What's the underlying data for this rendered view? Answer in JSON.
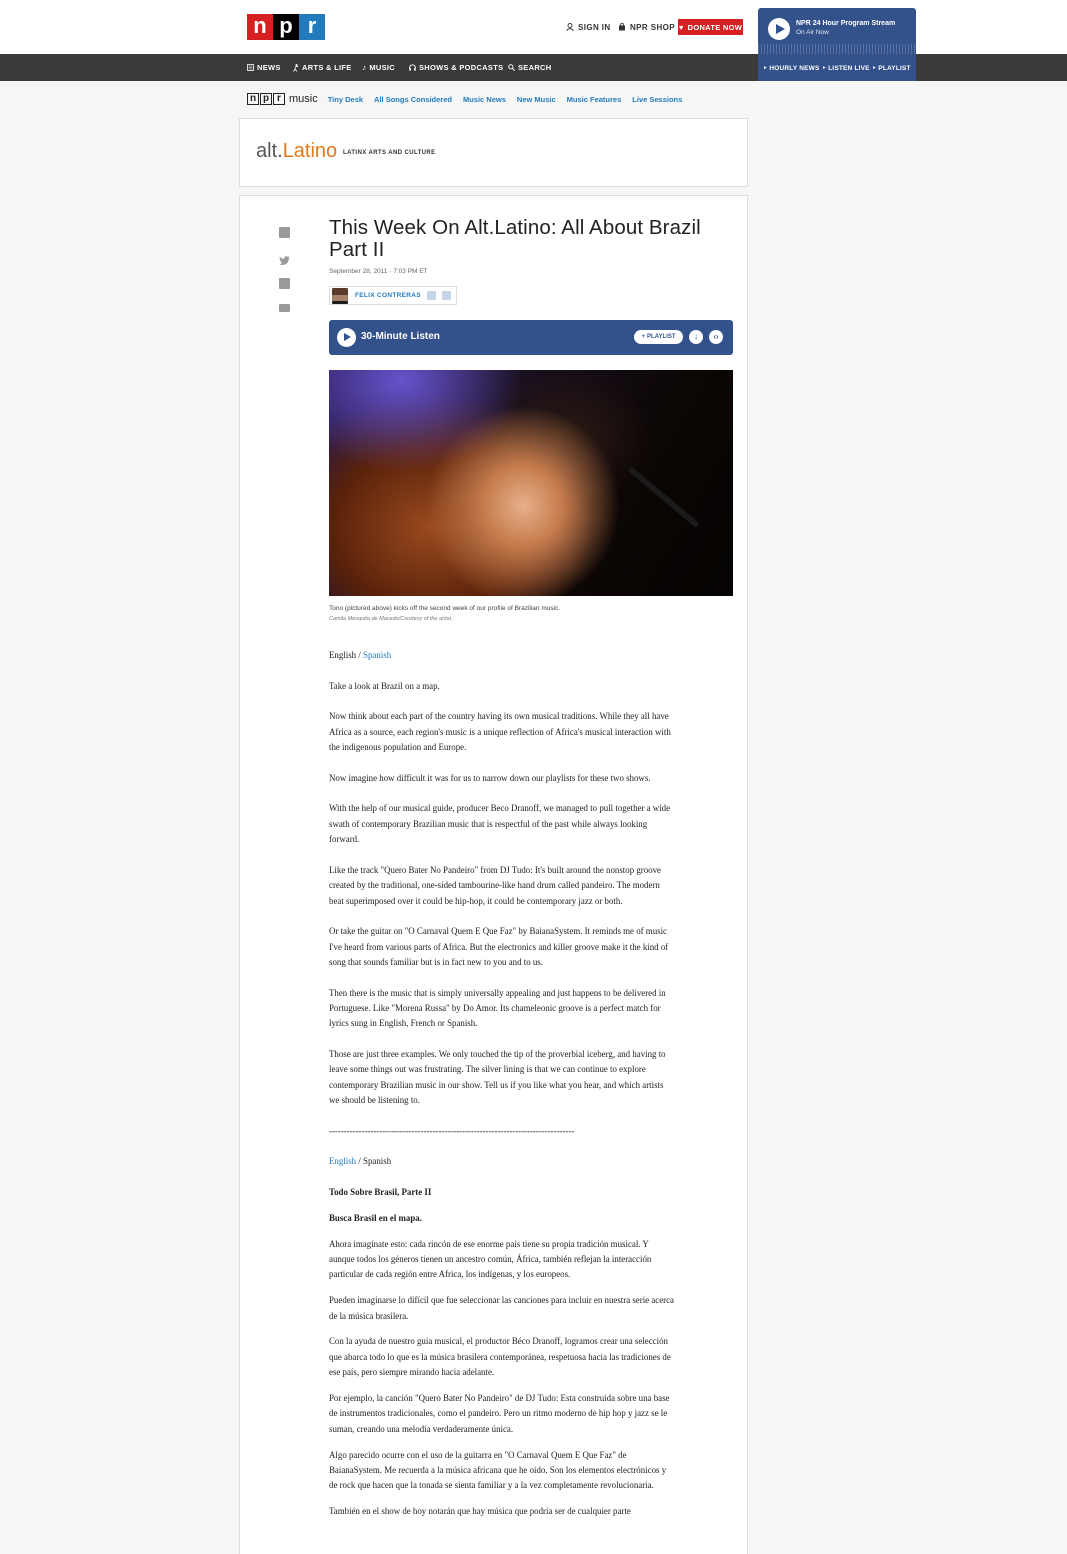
{
  "header": {
    "logo": [
      "n",
      "p",
      "r"
    ],
    "sign_in": "SIGN IN",
    "shop": "NPR SHOP",
    "donate": "DONATE NOW",
    "player": {
      "title": "NPR 24 Hour Program Stream",
      "subtitle": "On Air Now"
    },
    "player_links": [
      "HOURLY NEWS",
      "LISTEN LIVE",
      "PLAYLIST"
    ]
  },
  "nav": [
    "NEWS",
    "ARTS & LIFE",
    "MUSIC",
    "SHOWS & PODCASTS",
    "SEARCH"
  ],
  "subnav": {
    "brand_letters": [
      "n",
      "p",
      "r"
    ],
    "brand_word": "music",
    "links": [
      "Tiny Desk",
      "All Songs Considered",
      "Music News",
      "New Music",
      "Music Features",
      "Live Sessions"
    ]
  },
  "blog": {
    "name_prefix": "alt.",
    "name_suffix": "Latino",
    "tagline": "LATINX ARTS AND CULTURE"
  },
  "article": {
    "title": "This Week On Alt.Latino: All About Brazil Part II",
    "date": "September 28, 2011 · 7:03 PM ET",
    "author": "FELIX CONTRERAS",
    "audio": {
      "label": "30-Minute Listen",
      "playlist": "PLAYLIST"
    },
    "caption": "Tono (pictured above) kicks off the second week of our profile of Brazilian music.",
    "credit": "Camila Mesquita de Macedo/Courtesy of the artist.",
    "lang_en_1": "English",
    "lang_sep": " / ",
    "lang_es_1": "Spanish",
    "paragraphs_en": [
      "Take a look at Brazil on a map.",
      "Now think about each part of the country having its own musical traditions. While they all have Africa as a source, each region's music is a unique reflection of Africa's musical interaction with the indigenous population and Europe.",
      "Now imagine how difficult it was for us to narrow down our playlists for these two shows.",
      "With the help of our musical guide, producer Beco Dranoff, we managed to pull together a wide swath of contemporary Brazilian music that is respectful of the past while always looking forward.",
      "Like the track \"Quero Bater No Pandeiro\" from DJ Tudo: It's built around the nonstop groove created by the traditional, one-sided tambourine-like hand drum called pandeiro. The modern beat superimposed over it could be hip-hop, it could be contemporary jazz or both.",
      "Or take the guitar on \"O Carnaval Quem E Que Faz\" by BaianaSystem. It reminds me of music I've heard from various parts of Africa. But the electronics and killer groove make it the kind of song that sounds familiar but is in fact new to you and to us.",
      "Then there is the music that is simply universally appealing and just happens to be delivered in Portuguese. Like \"Morena Russa\" by Do Amor. Its chameleonic groove is a perfect match for lyrics sung in English, French or Spanish.",
      "Those are just three examples. We only touched the tip of the proverbial iceberg, and having to leave some things out was frustrating. The silver lining is that we can continue to explore contemporary Brazilian music in our show. Tell us if you like what you hear, and which artists we should be listening to."
    ],
    "divider": "-----------------------------------------------------------------------------------",
    "lang_en_2": "English",
    "lang_es_2": "Spanish",
    "es_title": "Todo Sobre Brasil, Parte II",
    "es_sub": "Busca Brasil en el mapa.",
    "paragraphs_es": [
      "Ahora imagínate esto: cada rincón de ese enorme país tiene su propia tradición musical. Y aunque todos los géneros tienen un ancestro común, África, también reflejan la interacción particular de cada región entre Africa, los indígenas, y los europeos.",
      "Pueden imaginarse lo difícil que fue seleccionar las canciones para incluir en nuestra serie acerca de la música brasilera.",
      "Con la ayuda de nuestro guía musical, el productor Béco Dranoff, logramos crear una selección que abarca todo lo que es la música brasilera contemporánea, respetuosa hacia las tradiciones de ese país, pero siempre mirando hacia adelante.",
      "Por ejemplo, la canción \"Quero Bater No Pandeiro\" de DJ Tudo: Esta construida sobre una base de instrumentos tradicionales, como el pandeiro. Pero un ritmo moderno de hip hop y jazz se le suman, creando una melodía verdaderamente única.",
      "Algo parecido ocurre con el uso de la guitarra en \"O Carnaval Quem E Que Faz\" de BaianaSystem. Me recuerda a la música africana que he oído. Son los elementos electrónicos y de rock que hacen que la tonada se sienta familiar y a la vez completamente revolucionaria.",
      "También en el show de hoy notarán que hay música que podría ser de cualquier parte"
    ]
  },
  "colors": {
    "npr_red": "#d62021",
    "npr_blue": "#237bbd",
    "player_blue": "#33528c",
    "nav_bg": "#3a3a3a",
    "latino_orange": "#e07a1a"
  }
}
